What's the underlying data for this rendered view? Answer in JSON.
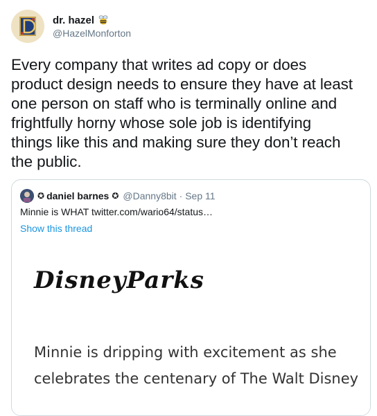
{
  "tweet": {
    "display_name": "dr. hazel",
    "handle": "@HazelMonforton",
    "avatar_letter": "D",
    "text": "Every company that writes ad copy or does\nproduct design needs to ensure they have at least\none person on staff who is terminally online and\nfrightfully horny whose sole job is identifying\nthings like this and making sure they don’t reach\nthe public."
  },
  "quoted_tweet": {
    "prefix_star": "✪",
    "display_name": "daniel barnes",
    "suffix_star": "✪",
    "handle": "@Danny8bit",
    "date": "· Sep 11",
    "text": "Minnie is WHAT  twitter.com/wario64/status…",
    "show_thread": "Show this thread"
  },
  "image": {
    "logo_text": "DisneyParks",
    "body_text": "Minnie is dripping with excitement as she celebrates the centenary of The Walt Disney"
  },
  "colors": {
    "link": "#1b95e0",
    "muted": "#657786",
    "border": "#cfd9de"
  },
  "icons": {
    "bee": "bee-icon",
    "avatar": "illuminated-letter-avatar"
  }
}
